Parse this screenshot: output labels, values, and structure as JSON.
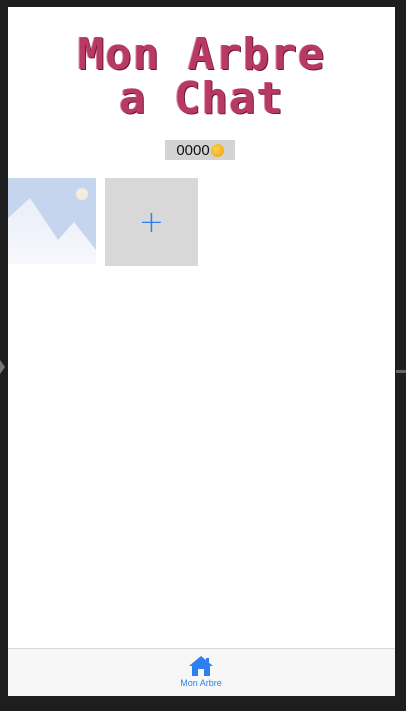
{
  "app": {
    "title_line1": "Mon Arbre",
    "title_line2": "a Chat"
  },
  "coins": {
    "value": "0000",
    "icon": "coin-icon"
  },
  "grid": {
    "items": [
      {
        "type": "image-placeholder",
        "icon": "image-placeholder-icon"
      },
      {
        "type": "add",
        "label": "+"
      }
    ]
  },
  "tabbar": {
    "tabs": [
      {
        "label": "Mon Arbre",
        "icon": "home-icon",
        "active": true
      }
    ]
  },
  "colors": {
    "title": "#b83a64",
    "accent": "#2f7ff0",
    "tile_bg": "#d8d8d8"
  }
}
